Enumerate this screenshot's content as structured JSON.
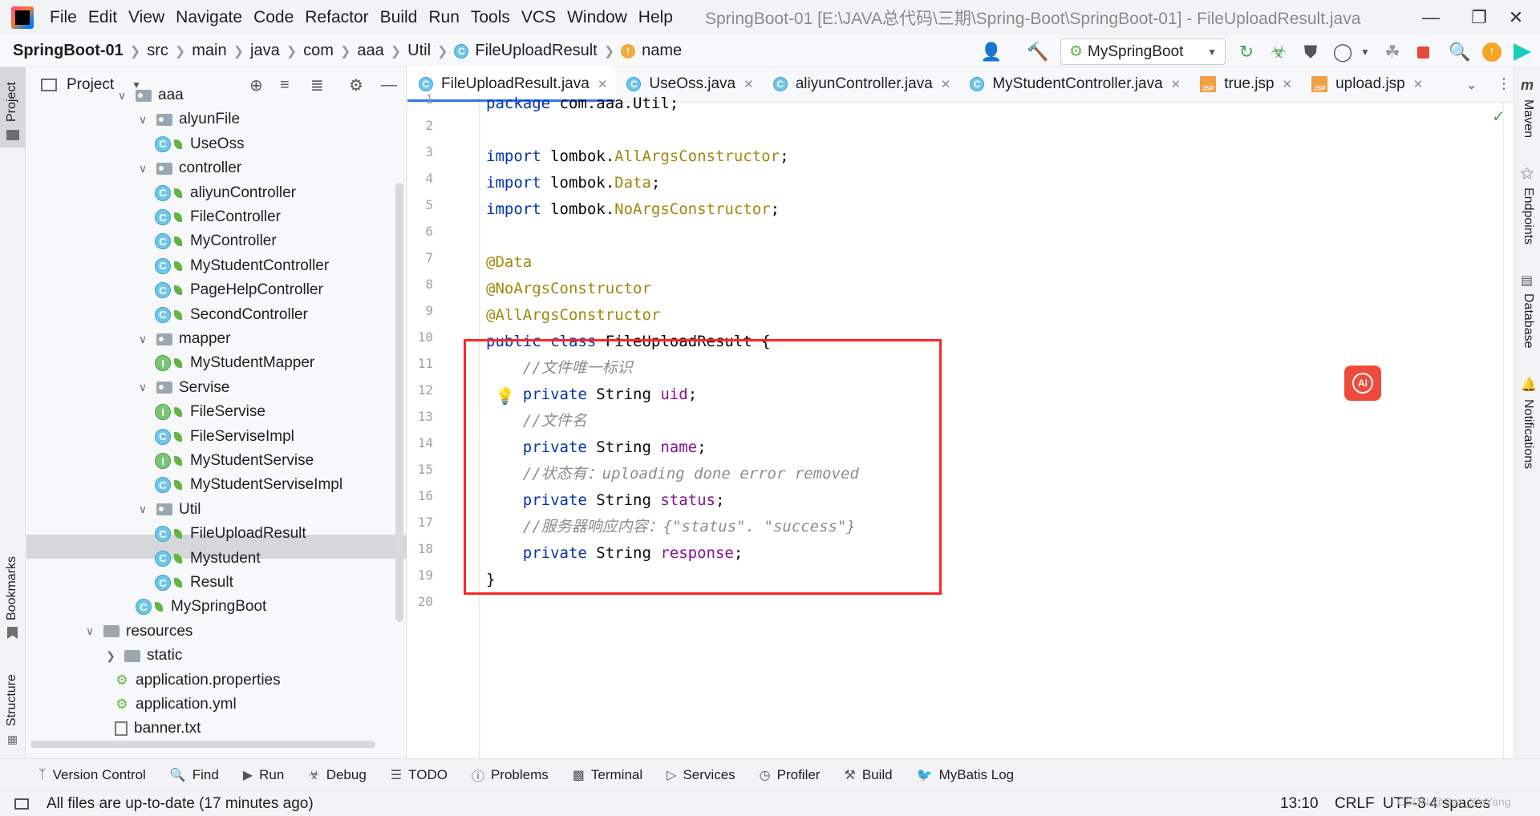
{
  "titlebar": {
    "menu": [
      "File",
      "Edit",
      "View",
      "Navigate",
      "Code",
      "Refactor",
      "Build",
      "Run",
      "Tools",
      "VCS",
      "Window",
      "Help"
    ],
    "window_title": "SpringBoot-01 [E:\\JAVA总代码\\三期\\Spring-Boot\\SpringBoot-01] - FileUploadResult.java"
  },
  "navbar": {
    "project": "SpringBoot-01",
    "crumbs": [
      "src",
      "main",
      "java",
      "com",
      "aaa",
      "Util",
      "FileUploadResult",
      "name"
    ],
    "run_config": "MySpringBoot"
  },
  "left_stripe": {
    "project": "Project",
    "bookmarks": "Bookmarks",
    "structure": "Structure"
  },
  "right_stripe": {
    "maven": "Maven",
    "endpoints": "Endpoints",
    "database": "Database",
    "notifications": "Notifications"
  },
  "project_panel": {
    "title": "Project",
    "tree": [
      {
        "label": "aaa",
        "kind": "package",
        "expanded": true
      },
      {
        "label": "alyunFile",
        "kind": "package",
        "expanded": true
      },
      {
        "label": "UseOss",
        "kind": "class"
      },
      {
        "label": "controller",
        "kind": "package",
        "expanded": true
      },
      {
        "label": "aliyunController",
        "kind": "class"
      },
      {
        "label": "FileController",
        "kind": "class"
      },
      {
        "label": "MyController",
        "kind": "class"
      },
      {
        "label": "MyStudentController",
        "kind": "class"
      },
      {
        "label": "PageHelpController",
        "kind": "class"
      },
      {
        "label": "SecondController",
        "kind": "class"
      },
      {
        "label": "mapper",
        "kind": "package",
        "expanded": true
      },
      {
        "label": "MyStudentMapper",
        "kind": "interface"
      },
      {
        "label": "Servise",
        "kind": "package",
        "expanded": true
      },
      {
        "label": "FileServise",
        "kind": "interface"
      },
      {
        "label": "FileServiseImpl",
        "kind": "class"
      },
      {
        "label": "MyStudentServise",
        "kind": "interface"
      },
      {
        "label": "MyStudentServiseImpl",
        "kind": "class"
      },
      {
        "label": "Util",
        "kind": "package",
        "expanded": true
      },
      {
        "label": "FileUploadResult",
        "kind": "class",
        "selected": true
      },
      {
        "label": "Mystudent",
        "kind": "class"
      },
      {
        "label": "Result",
        "kind": "class"
      },
      {
        "label": "MySpringBoot",
        "kind": "springboot"
      },
      {
        "label": "resources",
        "kind": "folder",
        "expanded": true
      },
      {
        "label": "static",
        "kind": "folder",
        "expanded": false
      },
      {
        "label": "application.properties",
        "kind": "config"
      },
      {
        "label": "application.yml",
        "kind": "config"
      },
      {
        "label": "banner.txt",
        "kind": "text"
      }
    ]
  },
  "tabs": [
    {
      "label": "FileUploadResult.java",
      "kind": "class",
      "active": true
    },
    {
      "label": "UseOss.java",
      "kind": "class"
    },
    {
      "label": "aliyunController.java",
      "kind": "class"
    },
    {
      "label": "MyStudentController.java",
      "kind": "class"
    },
    {
      "label": "true.jsp",
      "kind": "jsp"
    },
    {
      "label": "upload.jsp",
      "kind": "jsp"
    }
  ],
  "editor": {
    "line_numbers": [
      "1",
      "2",
      "3",
      "4",
      "5",
      "6",
      "7",
      "8",
      "9",
      "10",
      "11",
      "12",
      "13",
      "14",
      "15",
      "16",
      "17",
      "18",
      "19",
      "20"
    ],
    "current_line": 13,
    "lines": {
      "l1_kw": "package",
      "l1_rest": " com.aaa.Util;",
      "l3_kw": "import",
      "l3_a": " lombok.",
      "l3_b": "AllArgsConstructor",
      "l3_c": ";",
      "l4_kw": "import",
      "l4_a": " lombok.",
      "l4_b": "Data",
      "l4_c": ";",
      "l5_kw": "import",
      "l5_a": " lombok.",
      "l5_b": "NoArgsConstructor",
      "l5_c": ";",
      "l7": "@Data",
      "l8": "@NoArgsConstructor",
      "l9": "@AllArgsConstructor",
      "l10_kw": "public class",
      "l10_rest": " FileUploadResult {",
      "l11": "    //文件唯一标识",
      "l12_kw": "    private",
      "l12_a": " String ",
      "l12_f": "uid",
      "l12_c": ";",
      "l13": "    //文件名",
      "l14_kw": "    private",
      "l14_a": " String ",
      "l14_f": "name",
      "l14_c": ";",
      "l15": "    //状态有：uploading done error removed",
      "l16_kw": "    private",
      "l16_a": " String ",
      "l16_f": "status",
      "l16_c": ";",
      "l17": "    //服务器响应内容：{\"status\". \"success\"}",
      "l18_kw": "    private",
      "l18_a": " String ",
      "l18_f": "response",
      "l18_c": ";",
      "l19": "}"
    }
  },
  "bottom_tools": [
    "Version Control",
    "Find",
    "Run",
    "Debug",
    "TODO",
    "Problems",
    "Terminal",
    "Services",
    "Profiler",
    "Build",
    "MyBatis Log"
  ],
  "statusbar": {
    "message": "All files are up-to-date (17 minutes ago)",
    "position": "13:10",
    "line_sep": "CRLF",
    "encoding": "UTF-8",
    "indent": "4 spaces"
  },
  "watermark": "CSDN @Sez_XinYang",
  "ai_badge": "AI",
  "colors": {
    "keyword": "#0033b3",
    "annotation": "#9e880d",
    "comment": "#8c8c8c",
    "field": "#871094",
    "highlight_box": "#ff2626"
  }
}
